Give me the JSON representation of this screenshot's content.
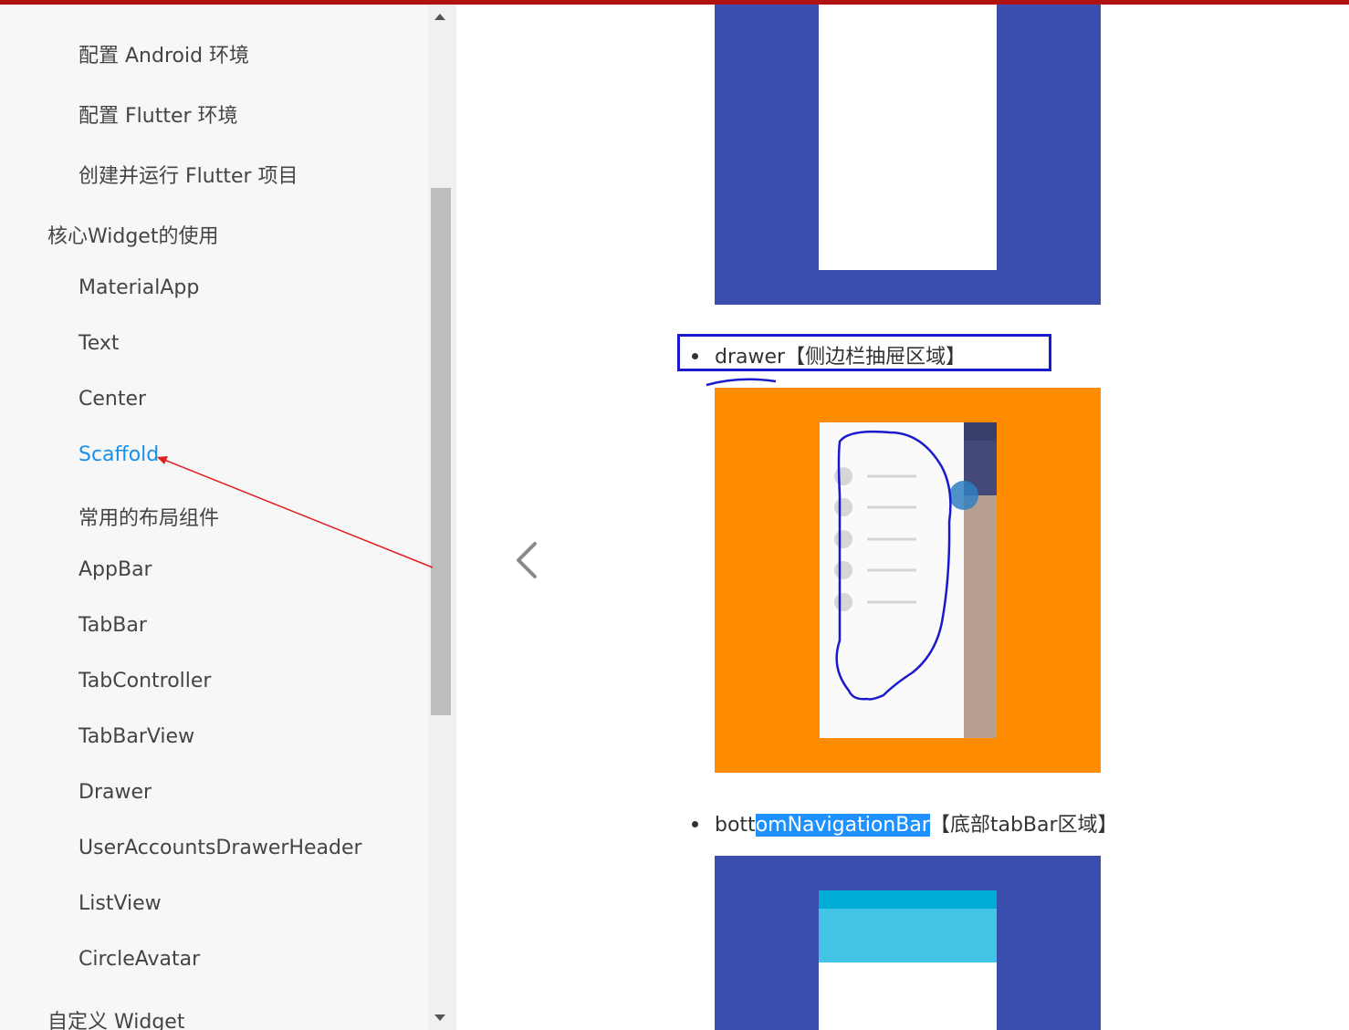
{
  "sidebar": {
    "items": [
      {
        "label": "配置 Android 环境",
        "level": "sub"
      },
      {
        "label": "配置 Flutter 环境",
        "level": "sub"
      },
      {
        "label": "创建并运行 Flutter 项目",
        "level": "sub"
      },
      {
        "label": "核心Widget的使用",
        "level": "top"
      },
      {
        "label": "MaterialApp",
        "level": "sub"
      },
      {
        "label": "Text",
        "level": "sub"
      },
      {
        "label": "Center",
        "level": "sub"
      },
      {
        "label": "Scaffold",
        "level": "sub",
        "active": true
      },
      {
        "label": "常用的布局组件",
        "level": "sub"
      },
      {
        "label": "AppBar",
        "level": "sub"
      },
      {
        "label": "TabBar",
        "level": "sub"
      },
      {
        "label": "TabController",
        "level": "sub"
      },
      {
        "label": "TabBarView",
        "level": "sub"
      },
      {
        "label": "Drawer",
        "level": "sub"
      },
      {
        "label": "UserAccountsDrawerHeader",
        "level": "sub"
      },
      {
        "label": "ListView",
        "level": "sub"
      },
      {
        "label": "CircleAvatar",
        "level": "sub"
      },
      {
        "label": "自定义 Widget",
        "level": "top"
      }
    ],
    "active_color": "#1a8fe8"
  },
  "content": {
    "drawer_bullet": {
      "name": "drawer",
      "desc": "【侧边栏抽屉区域】"
    },
    "bottom_bullet": {
      "prefix": "bott",
      "highlighted": "omNavigationBar",
      "desc": "【底部tabBar区域】"
    }
  },
  "colors": {
    "indigo": "#3a4fad",
    "orange": "#ff8c00",
    "annotation_blue": "#1a1acc",
    "annotation_red": "#e02020",
    "cyan": "#42c5e6",
    "cyan_dark": "#00acd4",
    "selection": "#1e90ff"
  }
}
